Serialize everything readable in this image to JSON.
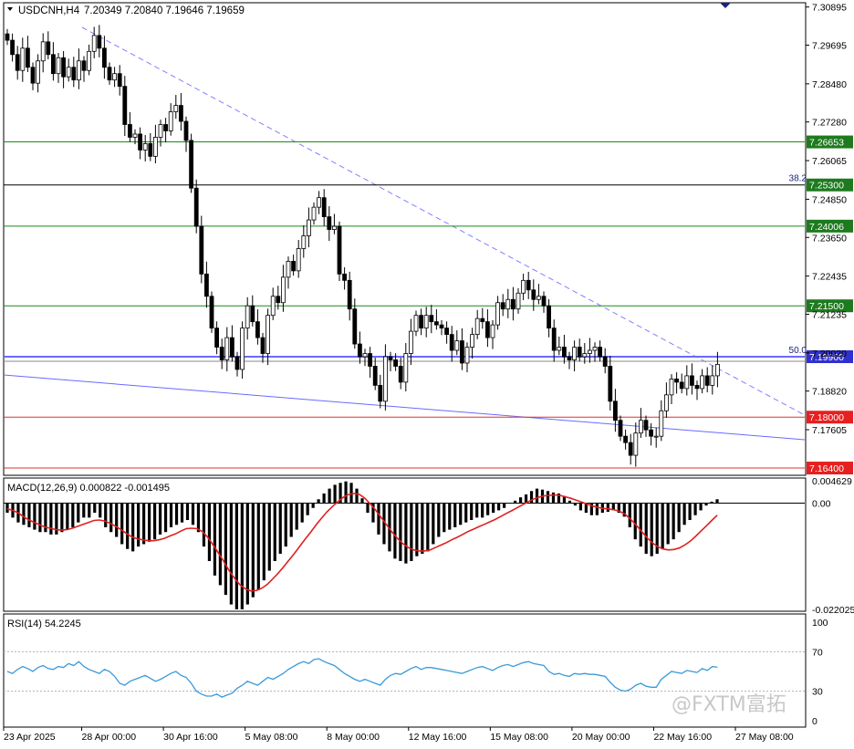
{
  "chart_header": {
    "title": "USDCNH,H4",
    "ohlc": "7.20349 7.20840 7.19646 7.19659"
  },
  "colors": {
    "candle_bull": "#ffffff",
    "candle_bear": "#000000",
    "candle_outline": "#000000",
    "support_green": "#1a8a1a",
    "support_red": "#e03030",
    "trend_line": "#6a6aff",
    "dashed_trend": "#8080ff",
    "signal_line": "#e02020",
    "rsi_line": "#3a9ad9",
    "label_green_bg": "#1e7a1e",
    "label_red_bg": "#e62020",
    "label_blue_bg": "#3030d0"
  },
  "price_axis": {
    "ticks": [
      "7.30895",
      "7.29695",
      "7.28480",
      "7.27280",
      "7.26065",
      "7.24850",
      "7.23650",
      "7.22435",
      "7.21235",
      "7.20020",
      "7.18820",
      "7.17605"
    ],
    "levels": [
      {
        "label": "7.26653",
        "value": 7.26653,
        "color": "green",
        "style": "solid"
      },
      {
        "label": "7.25300",
        "value": 7.253,
        "color": "black",
        "style": "solid",
        "fib": "38.2"
      },
      {
        "label": "7.24006",
        "value": 7.24006,
        "color": "green",
        "style": "solid"
      },
      {
        "label": "7.21500",
        "value": 7.215,
        "color": "green",
        "style": "solid"
      },
      {
        "label": "7.19900",
        "value": 7.199,
        "color": "blue",
        "style": "solid",
        "fib": "50.0"
      },
      {
        "label": "7.18000",
        "value": 7.18,
        "color": "red",
        "style": "solid"
      },
      {
        "label": "7.16400",
        "value": 7.164,
        "color": "red",
        "style": "solid"
      }
    ]
  },
  "time_axis": {
    "labels": [
      "23 Apr 2025",
      "28 Apr 00:00",
      "30 Apr 16:00",
      "5 May 08:00",
      "8 May 00:00",
      "12 May 16:00",
      "15 May 08:00",
      "20 May 00:00",
      "22 May 16:00",
      "27 May 08:00"
    ]
  },
  "macd": {
    "title": "MACD(12,26,9) 0.000822 -0.001495",
    "ticks": [
      "0.004629",
      "0.00",
      "-0.022025"
    ]
  },
  "rsi": {
    "title": "RSI(14) 54.2245",
    "ticks": [
      "100",
      "70",
      "30",
      "0"
    ]
  },
  "watermark": "@FXTM富拓",
  "chart_data": [
    {
      "type": "candlestick",
      "title": "USDCNH,H4",
      "ylim": [
        7.162,
        7.31
      ],
      "levels": [
        7.26653,
        7.253,
        7.24006,
        7.215,
        7.199,
        7.18,
        7.164
      ],
      "ohlc_last": {
        "open": 7.20349,
        "high": 7.2084,
        "low": 7.19646,
        "close": 7.19659
      },
      "closes": [
        7.2985,
        7.294,
        7.289,
        7.296,
        7.29,
        7.285,
        7.292,
        7.298,
        7.294,
        7.288,
        7.293,
        7.287,
        7.29,
        7.286,
        7.292,
        7.289,
        7.295,
        7.3,
        7.296,
        7.29,
        7.286,
        7.288,
        7.284,
        7.272,
        7.268,
        7.269,
        7.264,
        7.266,
        7.262,
        7.268,
        7.272,
        7.27,
        7.276,
        7.278,
        7.273,
        7.267,
        7.252,
        7.24,
        7.225,
        7.218,
        7.208,
        7.202,
        7.198,
        7.205,
        7.199,
        7.195,
        7.208,
        7.215,
        7.21,
        7.205,
        7.2,
        7.212,
        7.218,
        7.216,
        7.224,
        7.229,
        7.226,
        7.233,
        7.237,
        7.242,
        7.246,
        7.249,
        7.243,
        7.239,
        7.24,
        7.225,
        7.223,
        7.214,
        7.203,
        7.199,
        7.2,
        7.196,
        7.19,
        7.185,
        7.199,
        7.198,
        7.196,
        7.191,
        7.2,
        7.207,
        7.212,
        7.208,
        7.212,
        7.21,
        7.209,
        7.208,
        7.206,
        7.201,
        7.204,
        7.197,
        7.202,
        7.206,
        7.211,
        7.21,
        7.205,
        7.209,
        7.216,
        7.214,
        7.217,
        7.214,
        7.219,
        7.223,
        7.22,
        7.217,
        7.218,
        7.215,
        7.208,
        7.201,
        7.202,
        7.199,
        7.198,
        7.202,
        7.199,
        7.2,
        7.201,
        7.202,
        7.199,
        7.196,
        7.185,
        7.179,
        7.174,
        7.172,
        7.168,
        7.175,
        7.179,
        7.176,
        7.174,
        7.174,
        7.182,
        7.187,
        7.192,
        7.191,
        7.189,
        7.193,
        7.19,
        7.189,
        7.193,
        7.19,
        7.193,
        7.1966
      ],
      "macd_histogram": [
        -0.002,
        -0.003,
        -0.004,
        -0.0045,
        -0.005,
        -0.0055,
        -0.006,
        -0.006,
        -0.0065,
        -0.0065,
        -0.006,
        -0.0055,
        -0.005,
        -0.004,
        -0.003,
        -0.003,
        -0.002,
        -0.003,
        -0.005,
        -0.006,
        -0.007,
        -0.0085,
        -0.0095,
        -0.01,
        -0.009,
        -0.0085,
        -0.008,
        -0.0075,
        -0.0065,
        -0.006,
        -0.005,
        -0.0045,
        -0.004,
        -0.0035,
        -0.0045,
        -0.006,
        -0.009,
        -0.012,
        -0.015,
        -0.017,
        -0.019,
        -0.021,
        -0.022,
        -0.022,
        -0.021,
        -0.0195,
        -0.018,
        -0.016,
        -0.014,
        -0.012,
        -0.0105,
        -0.009,
        -0.007,
        -0.0055,
        -0.004,
        -0.0025,
        -0.001,
        0.0008,
        0.002,
        0.003,
        0.0038,
        0.0042,
        0.0045,
        0.0042,
        0.003,
        0.001,
        -0.002,
        -0.004,
        -0.0065,
        -0.0085,
        -0.01,
        -0.0115,
        -0.012,
        -0.0125,
        -0.012,
        -0.011,
        -0.0105,
        -0.01,
        -0.0085,
        -0.007,
        -0.006,
        -0.0055,
        -0.005,
        -0.0045,
        -0.004,
        -0.0035,
        -0.003,
        -0.003,
        -0.0025,
        -0.002,
        -0.0015,
        -0.001,
        0.0,
        0.0005,
        0.0012,
        0.0018,
        0.0025,
        0.003,
        0.0028,
        0.0025,
        0.0022,
        0.002,
        0.0015,
        0.0005,
        -0.0005,
        -0.0015,
        -0.002,
        -0.0025,
        -0.0025,
        -0.002,
        -0.0018,
        -0.0015,
        -0.002,
        -0.0028,
        -0.005,
        -0.0075,
        -0.009,
        -0.0105,
        -0.011,
        -0.0105,
        -0.0095,
        -0.0085,
        -0.0075,
        -0.006,
        -0.0045,
        -0.0035,
        -0.0025,
        -0.0015,
        -0.0005,
        0.0003,
        0.0008
      ],
      "macd_signal": [
        -0.0012,
        -0.0015,
        -0.002,
        -0.0028,
        -0.0035,
        -0.004,
        -0.0045,
        -0.005,
        -0.0052,
        -0.0055,
        -0.0056,
        -0.0055,
        -0.0052,
        -0.0048,
        -0.0044,
        -0.004,
        -0.0036,
        -0.0035,
        -0.0037,
        -0.0042,
        -0.0048,
        -0.0055,
        -0.0063,
        -0.007,
        -0.0074,
        -0.0076,
        -0.0078,
        -0.0078,
        -0.0076,
        -0.0073,
        -0.0068,
        -0.0064,
        -0.0058,
        -0.0053,
        -0.0052,
        -0.0053,
        -0.0059,
        -0.0071,
        -0.0087,
        -0.0104,
        -0.0122,
        -0.0141,
        -0.0157,
        -0.017,
        -0.0178,
        -0.0182,
        -0.0181,
        -0.0176,
        -0.0168,
        -0.0157,
        -0.0145,
        -0.0132,
        -0.0118,
        -0.0104,
        -0.0089,
        -0.0074,
        -0.006,
        -0.0045,
        -0.0031,
        -0.0018,
        -0.0007,
        0.0003,
        0.0012,
        0.0018,
        0.002,
        0.0018,
        0.001,
        -0.0002,
        -0.0015,
        -0.003,
        -0.0045,
        -0.006,
        -0.0073,
        -0.0084,
        -0.0092,
        -0.0097,
        -0.0099,
        -0.0099,
        -0.0097,
        -0.0092,
        -0.0087,
        -0.0082,
        -0.0076,
        -0.0071,
        -0.0065,
        -0.0059,
        -0.0054,
        -0.0049,
        -0.0044,
        -0.0039,
        -0.0034,
        -0.0028,
        -0.0022,
        -0.0016,
        -0.001,
        -0.0004,
        0.0002,
        0.0008,
        0.0012,
        0.0015,
        0.0016,
        0.0017,
        0.0016,
        0.0013,
        0.001,
        0.0006,
        0.0002,
        -0.0002,
        -0.0006,
        -0.0009,
        -0.0011,
        -0.0012,
        -0.0014,
        -0.0017,
        -0.0023,
        -0.0033,
        -0.0045,
        -0.0058,
        -0.0071,
        -0.0082,
        -0.009,
        -0.0095,
        -0.0097,
        -0.0096,
        -0.0093,
        -0.0087,
        -0.0079,
        -0.0069,
        -0.0058,
        -0.0047,
        -0.0036,
        -0.0025
      ],
      "rsi": [
        50,
        48,
        52,
        55,
        53,
        50,
        54,
        56,
        53,
        52,
        55,
        54,
        58,
        56,
        60,
        55,
        52,
        50,
        48,
        52,
        50,
        45,
        38,
        36,
        40,
        42,
        44,
        46,
        43,
        40,
        42,
        45,
        48,
        50,
        46,
        44,
        38,
        30,
        27,
        25,
        25,
        27,
        24,
        26,
        28,
        33,
        36,
        40,
        38,
        36,
        40,
        44,
        42,
        45,
        48,
        52,
        55,
        58,
        60,
        58,
        62,
        63,
        60,
        58,
        56,
        52,
        48,
        45,
        42,
        40,
        42,
        40,
        38,
        36,
        42,
        46,
        48,
        47,
        50,
        53,
        55,
        52,
        54,
        54,
        53,
        52,
        51,
        50,
        49,
        48,
        50,
        52,
        54,
        55,
        53,
        51,
        54,
        56,
        57,
        55,
        57,
        59,
        60,
        58,
        57,
        56,
        50,
        47,
        48,
        46,
        45,
        48,
        47,
        48,
        47,
        47,
        46,
        45,
        39,
        34,
        31,
        30,
        32,
        36,
        38,
        35,
        34,
        34,
        42,
        46,
        50,
        49,
        48,
        51,
        50,
        49,
        53,
        51,
        55,
        54.2245
      ]
    }
  ]
}
